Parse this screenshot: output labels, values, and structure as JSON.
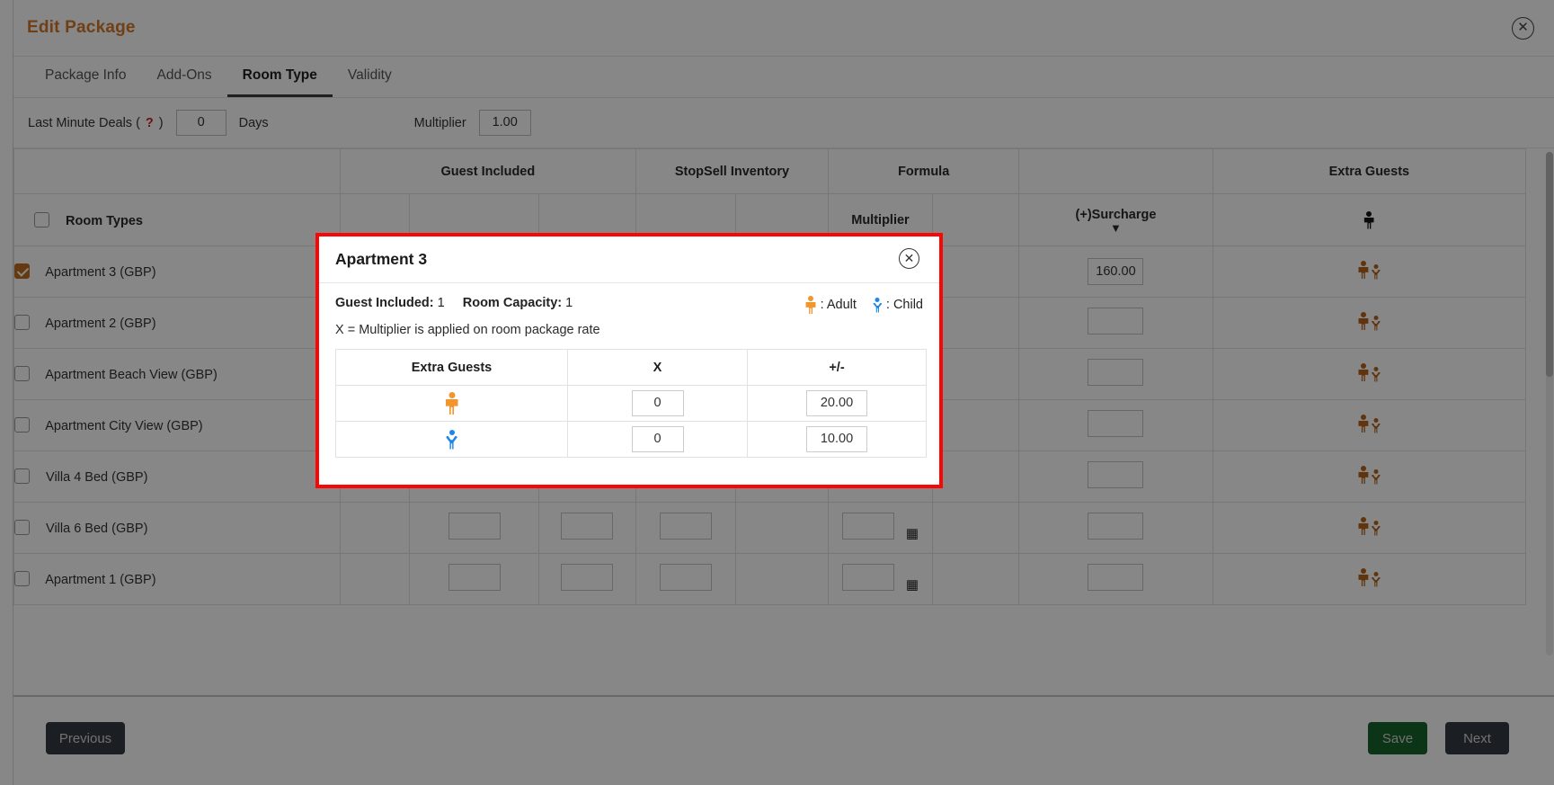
{
  "window": {
    "title": "Edit Package",
    "close_icon": "close-circle-icon"
  },
  "tabs": [
    {
      "label": "Package Info",
      "active": false
    },
    {
      "label": "Add-Ons",
      "active": false
    },
    {
      "label": "Room Type",
      "active": true
    },
    {
      "label": "Validity",
      "active": false
    }
  ],
  "filters": {
    "last_minute_label": "Last Minute Deals (",
    "help_marker": "?",
    "last_minute_label_end": ")",
    "last_minute_value": "0",
    "days_label": "Days",
    "multiplier_label": "Multiplier",
    "multiplier_value": "1.00"
  },
  "table": {
    "group_headers": [
      "",
      "Guest Included",
      "StopSell Inventory",
      "Formula",
      "Extra Guests"
    ],
    "sub_headers": {
      "room_types": "Room Types",
      "multiplier": "Multiplier",
      "surcharge": "(+)Surcharge",
      "surcharge_chevron": "chevron-double-down-icon"
    },
    "rows": [
      {
        "name": "Apartment 3 (GBP)",
        "checked": true,
        "surcharge": "160.00",
        "calc": false
      },
      {
        "name": "Apartment 2 (GBP)",
        "checked": false,
        "surcharge": "",
        "calc": false
      },
      {
        "name": "Apartment Beach View (GBP)",
        "checked": false,
        "surcharge": "",
        "calc": false
      },
      {
        "name": "Apartment City View (GBP)",
        "checked": false,
        "surcharge": "",
        "calc": false
      },
      {
        "name": "Villa 4 Bed (GBP)",
        "checked": false,
        "surcharge": "",
        "calc": true
      },
      {
        "name": "Villa 6 Bed (GBP)",
        "checked": false,
        "surcharge": "",
        "calc": true
      },
      {
        "name": "Apartment 1 (GBP)",
        "checked": false,
        "surcharge": "",
        "calc": true
      }
    ]
  },
  "footer": {
    "previous_label": "Previous",
    "save_label": "Save",
    "next_label": "Next"
  },
  "modal": {
    "title": "Apartment 3",
    "close_icon": "close-circle-icon",
    "guest_included_label": "Guest Included:",
    "guest_included_value": "1",
    "room_capacity_label": "Room Capacity:",
    "room_capacity_value": "1",
    "legend_adult": ": Adult",
    "legend_child": ": Child",
    "note": "X = Multiplier is applied on room package rate",
    "columns": [
      "Extra Guests",
      "X",
      "+/-"
    ],
    "rows": [
      {
        "guest_type": "adult",
        "x": "0",
        "plusminus": "20.00"
      },
      {
        "guest_type": "child",
        "x": "0",
        "plusminus": "10.00"
      }
    ]
  },
  "colors": {
    "accent": "#d2792a",
    "checkbox_checked": "#c06f20",
    "adult": "#f0962d",
    "child": "#1f86e8",
    "save": "#17622a",
    "modal_border": "#fb0505"
  }
}
